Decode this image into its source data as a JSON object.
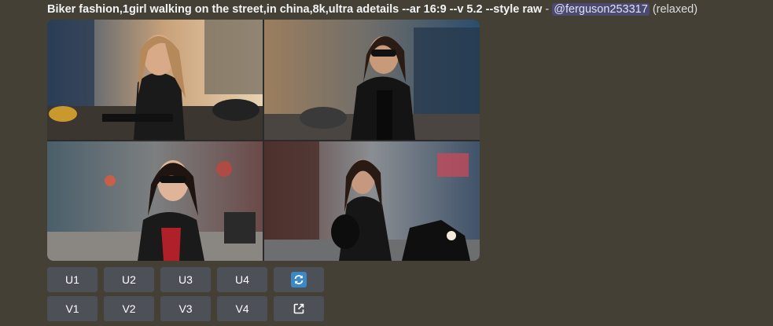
{
  "message": {
    "prompt": "Biker fashion,1girl walking on the street,in china,8k,ultra adetails --ar 16:9 --v 5.2 --style raw",
    "separator": " - ",
    "mention": "@ferguson253317",
    "mode": "(relaxed)"
  },
  "images": [
    {
      "id": 1,
      "icon": "image-biker-woman-street"
    },
    {
      "id": 2,
      "icon": "image-biker-woman-sunglasses"
    },
    {
      "id": 3,
      "icon": "image-biker-woman-red-top"
    },
    {
      "id": 4,
      "icon": "image-biker-woman-motorcycle"
    }
  ],
  "buttons": {
    "upscale": [
      "U1",
      "U2",
      "U3",
      "U4"
    ],
    "variation": [
      "V1",
      "V2",
      "V3",
      "V4"
    ],
    "reroll_icon": "refresh-icon",
    "web_icon": "external-link-icon"
  },
  "colors": {
    "background": "#454035",
    "button": "#4e5058",
    "reroll": "#3b88c3",
    "mention_bg": "#5865f2"
  }
}
